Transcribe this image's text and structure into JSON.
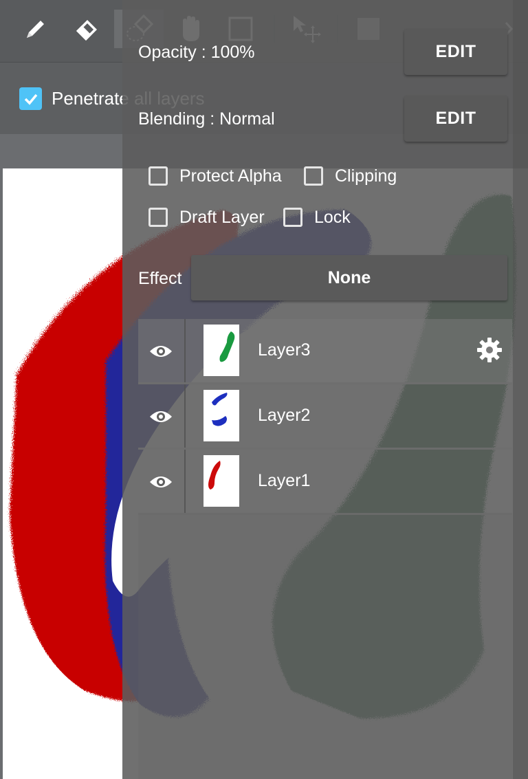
{
  "toolbar": {
    "tools": [
      "pen-icon",
      "eraser-icon",
      "soft-eraser-icon",
      "hand-icon",
      "rectangle-select-icon",
      "move-icon",
      "fill-square-icon",
      "more-tools-icon"
    ]
  },
  "options": {
    "penetrate_label": "Penetrate all layers",
    "penetrate_checked": true
  },
  "panel": {
    "opacity_label": "Opacity : 100%",
    "blending_label": "Blending : Normal",
    "edit_label": "EDIT",
    "protect_alpha_label": "Protect Alpha",
    "clipping_label": "Clipping",
    "draft_layer_label": "Draft Layer",
    "lock_label": "Lock",
    "effect_label": "Effect",
    "effect_value": "None"
  },
  "layers": [
    {
      "name": "Layer3",
      "selected": true,
      "color": "#1a9a40"
    },
    {
      "name": "Layer2",
      "selected": false,
      "color": "#1d2fbf"
    },
    {
      "name": "Layer1",
      "selected": false,
      "color": "#cc0a0a"
    }
  ],
  "colors": {
    "accent_checkbox": "#4fc3f7",
    "paint_red": "#c80000",
    "paint_blue": "#22259a",
    "paint_green": "#2e6b3c"
  }
}
